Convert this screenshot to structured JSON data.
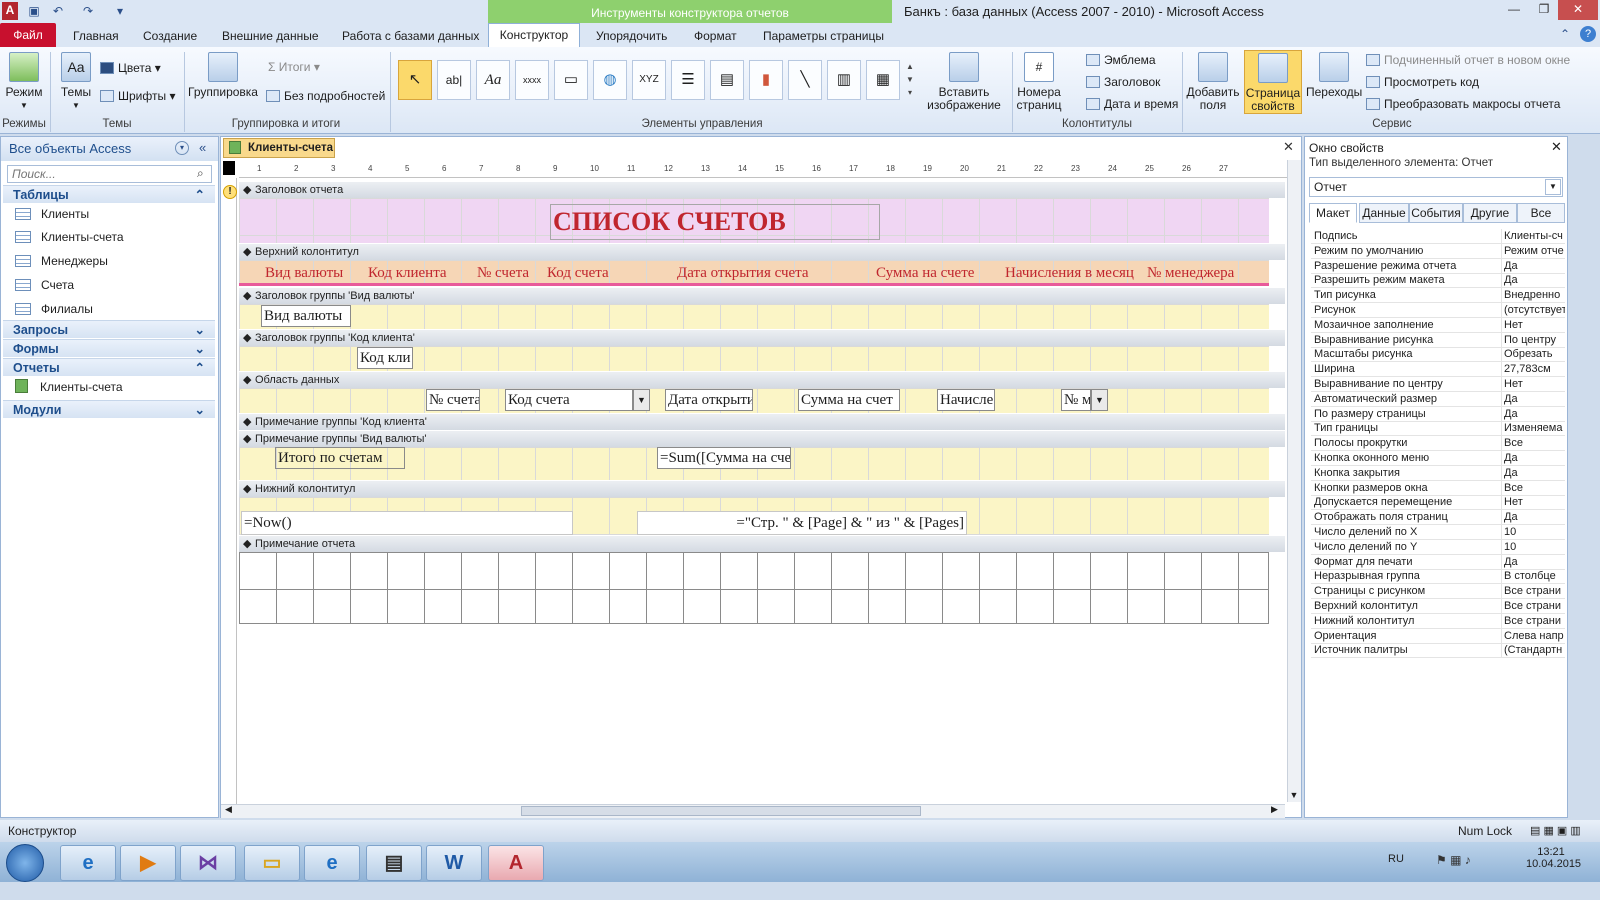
{
  "window": {
    "title": "Банкъ : база данных (Access 2007 - 2010)  -  Microsoft Access",
    "context_tools": "Инструменты конструктора отчетов"
  },
  "tabs": [
    "Файл",
    "Главная",
    "Создание",
    "Внешние данные",
    "Работа с базами данных",
    "Конструктор",
    "Упорядочить",
    "Формат",
    "Параметры страницы"
  ],
  "ribbon": {
    "view": "Режим",
    "themes": "Темы",
    "colors": "Цвета",
    "fonts": "Шрифты",
    "group": "Группировка",
    "totals": "Итоги",
    "hide_details": "Без подробностей",
    "insert_image": "Вставить изображение",
    "page_numbers": "Номера страниц",
    "logo": "Эмблема",
    "title": "Заголовок",
    "date_time": "Дата и время",
    "add_fields": "Добавить поля",
    "property_sheet": "Страница свойств",
    "tab_order": "Переходы",
    "subreport": "Подчиненный отчет в новом окне",
    "view_code": "Просмотреть код",
    "convert_macros": "Преобразовать макросы отчета",
    "groups": {
      "views": "Режимы",
      "themes": "Темы",
      "grouping": "Группировка и итоги",
      "controls": "Элементы управления",
      "headers": "Колонтитулы",
      "tools": "Сервис"
    }
  },
  "nav": {
    "header": "Все объекты Access",
    "search_placeholder": "Поиск...",
    "tables_label": "Таблицы",
    "tables": [
      "Клиенты",
      "Клиенты-счета",
      "Менеджеры",
      "Счета",
      "Филиалы"
    ],
    "queries": "Запросы",
    "forms": "Формы",
    "reports_label": "Отчеты",
    "reports": [
      "Клиенты-счета"
    ],
    "modules": "Модули"
  },
  "document": {
    "tab": "Клиенты-счета",
    "sections": {
      "report_header": "Заголовок отчета",
      "page_header": "Верхний колонтитул",
      "group_currency": "Заголовок группы 'Вид валюты'",
      "group_client": "Заголовок группы 'Код клиента'",
      "detail": "Область данных",
      "group_client_footer": "Примечание группы 'Код клиента'",
      "group_currency_footer": "Примечание группы 'Вид валюты'",
      "page_footer": "Нижний колонтитул",
      "report_footer": "Примечание отчета"
    },
    "report_title": "СПИСОК СЧЕТОВ",
    "column_headers": [
      "Вид валюты",
      "Код клиента",
      "№ счета",
      "Код счета",
      "Дата открытия счета",
      "Сумма на счете",
      "Начисления в месяц",
      "№ менеджера"
    ],
    "group_currency_field": "Вид валюты",
    "group_client_field": "Код кли",
    "detail_fields": [
      "№ счета",
      "Код счета",
      "Дата открыти",
      "Сумма на счет",
      "Начисле",
      "№ м"
    ],
    "totals_label": "Итого по счетам",
    "totals_expr": "=Sum([Сумма на сче",
    "footer_now": "=Now()",
    "footer_pages": "=\"Стр. \" & [Page] & \" из \" & [Pages]",
    "ruler_numbers": [
      "1",
      "2",
      "3",
      "4",
      "5",
      "6",
      "7",
      "8",
      "9",
      "10",
      "11",
      "12",
      "13",
      "14",
      "15",
      "16",
      "17",
      "18",
      "19",
      "20",
      "21",
      "22",
      "23",
      "24",
      "25",
      "26",
      "27"
    ]
  },
  "props": {
    "title": "Окно свойств",
    "selection_type": "Тип выделенного элемента:  Отчет",
    "selected": "Отчет",
    "tabs": [
      "Макет",
      "Данные",
      "События",
      "Другие",
      "Все"
    ],
    "rows": [
      [
        "Подпись",
        "Клиенты-сч"
      ],
      [
        "Режим по умолчанию",
        "Режим отче"
      ],
      [
        "Разрешение режима отчета",
        "Да"
      ],
      [
        "Разрешить режим макета",
        "Да"
      ],
      [
        "Тип рисунка",
        "Внедренно"
      ],
      [
        "Рисунок",
        "(отсутствует"
      ],
      [
        "Мозаичное заполнение",
        "Нет"
      ],
      [
        "Выравнивание рисунка",
        "По центру"
      ],
      [
        "Масштабы рисунка",
        "Обрезать"
      ],
      [
        "Ширина",
        "27,783см"
      ],
      [
        "Выравнивание по центру",
        "Нет"
      ],
      [
        "Автоматический размер",
        "Да"
      ],
      [
        "По размеру страницы",
        "Да"
      ],
      [
        "Тип границы",
        "Изменяема"
      ],
      [
        "Полосы прокрутки",
        "Все"
      ],
      [
        "Кнопка оконного меню",
        "Да"
      ],
      [
        "Кнопка закрытия",
        "Да"
      ],
      [
        "Кнопки размеров окна",
        "Все"
      ],
      [
        "Допускается перемещение",
        "Нет"
      ],
      [
        "Отображать поля страниц",
        "Да"
      ],
      [
        "Число делений по X",
        "10"
      ],
      [
        "Число делений по Y",
        "10"
      ],
      [
        "Формат для печати",
        "Да"
      ],
      [
        "Неразрывная группа",
        "В столбце"
      ],
      [
        "Страницы с рисунком",
        "Все страни"
      ],
      [
        "Верхний колонтитул",
        "Все страни"
      ],
      [
        "Нижний колонтитул",
        "Все страни"
      ],
      [
        "Ориентация",
        "Слева напр"
      ],
      [
        "Источник палитры",
        "(Стандартн"
      ]
    ]
  },
  "status": {
    "left": "Конструктор",
    "numlock": "Num Lock"
  },
  "taskbar": {
    "lang": "RU",
    "time": "13:21",
    "date": "10.04.2015"
  }
}
